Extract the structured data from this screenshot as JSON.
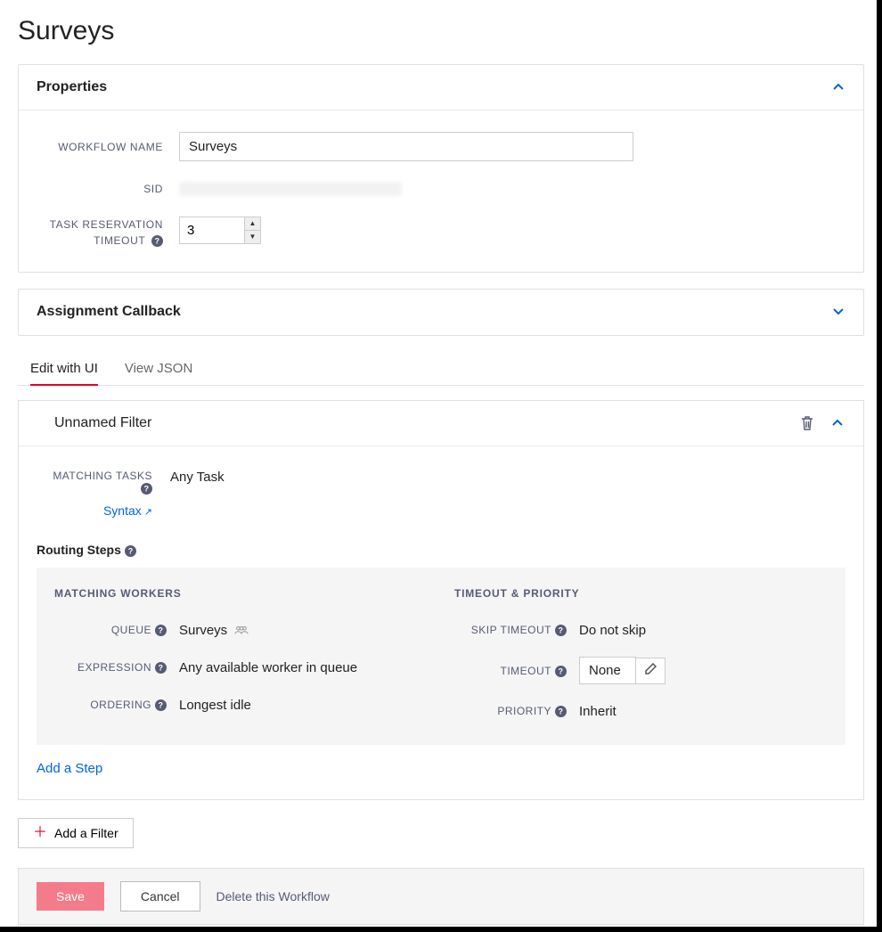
{
  "page": {
    "title": "Surveys"
  },
  "properties": {
    "panel_title": "Properties",
    "labels": {
      "workflow_name": "WORKFLOW NAME",
      "sid": "SID",
      "task_reservation_timeout": "TASK RESERVATION TIMEOUT"
    },
    "values": {
      "workflow_name": "Surveys",
      "task_reservation_timeout": "3"
    }
  },
  "assignment_callback": {
    "panel_title": "Assignment Callback"
  },
  "tabs": {
    "edit_with_ui": "Edit with UI",
    "view_json": "View JSON"
  },
  "filter": {
    "title": "Unnamed Filter",
    "matching_tasks_label": "MATCHING TASKS",
    "matching_tasks_value": "Any Task",
    "syntax_link": "Syntax",
    "routing_steps_title": "Routing Steps",
    "step": {
      "matching_workers_title": "MATCHING WORKERS",
      "timeout_priority_title": "TIMEOUT & PRIORITY",
      "labels": {
        "queue": "QUEUE",
        "expression": "EXPRESSION",
        "ordering": "ORDERING",
        "skip_timeout": "SKIP TIMEOUT",
        "timeout": "TIMEOUT",
        "priority": "PRIORITY"
      },
      "values": {
        "queue": "Surveys",
        "expression": "Any available worker in queue",
        "ordering": "Longest idle",
        "skip_timeout": "Do not skip",
        "timeout": "None",
        "priority": "Inherit"
      }
    },
    "add_step": "Add a Step"
  },
  "add_filter": "Add a Filter",
  "footer": {
    "save": "Save",
    "cancel": "Cancel",
    "delete": "Delete this Workflow"
  }
}
